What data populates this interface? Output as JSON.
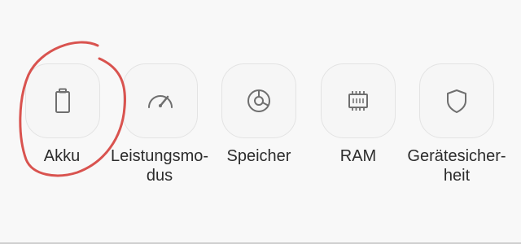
{
  "items": [
    {
      "label": "Akku",
      "icon": "battery-icon"
    },
    {
      "label": "Leistungsmo-\ndus",
      "icon": "speedometer-icon"
    },
    {
      "label": "Speicher",
      "icon": "storage-chart-icon"
    },
    {
      "label": "RAM",
      "icon": "memory-chip-icon"
    },
    {
      "label": "Gerätesicher-\nheit",
      "icon": "shield-icon"
    }
  ],
  "colors": {
    "icon": "#6f6f6f",
    "annotation": "#d9534f"
  }
}
